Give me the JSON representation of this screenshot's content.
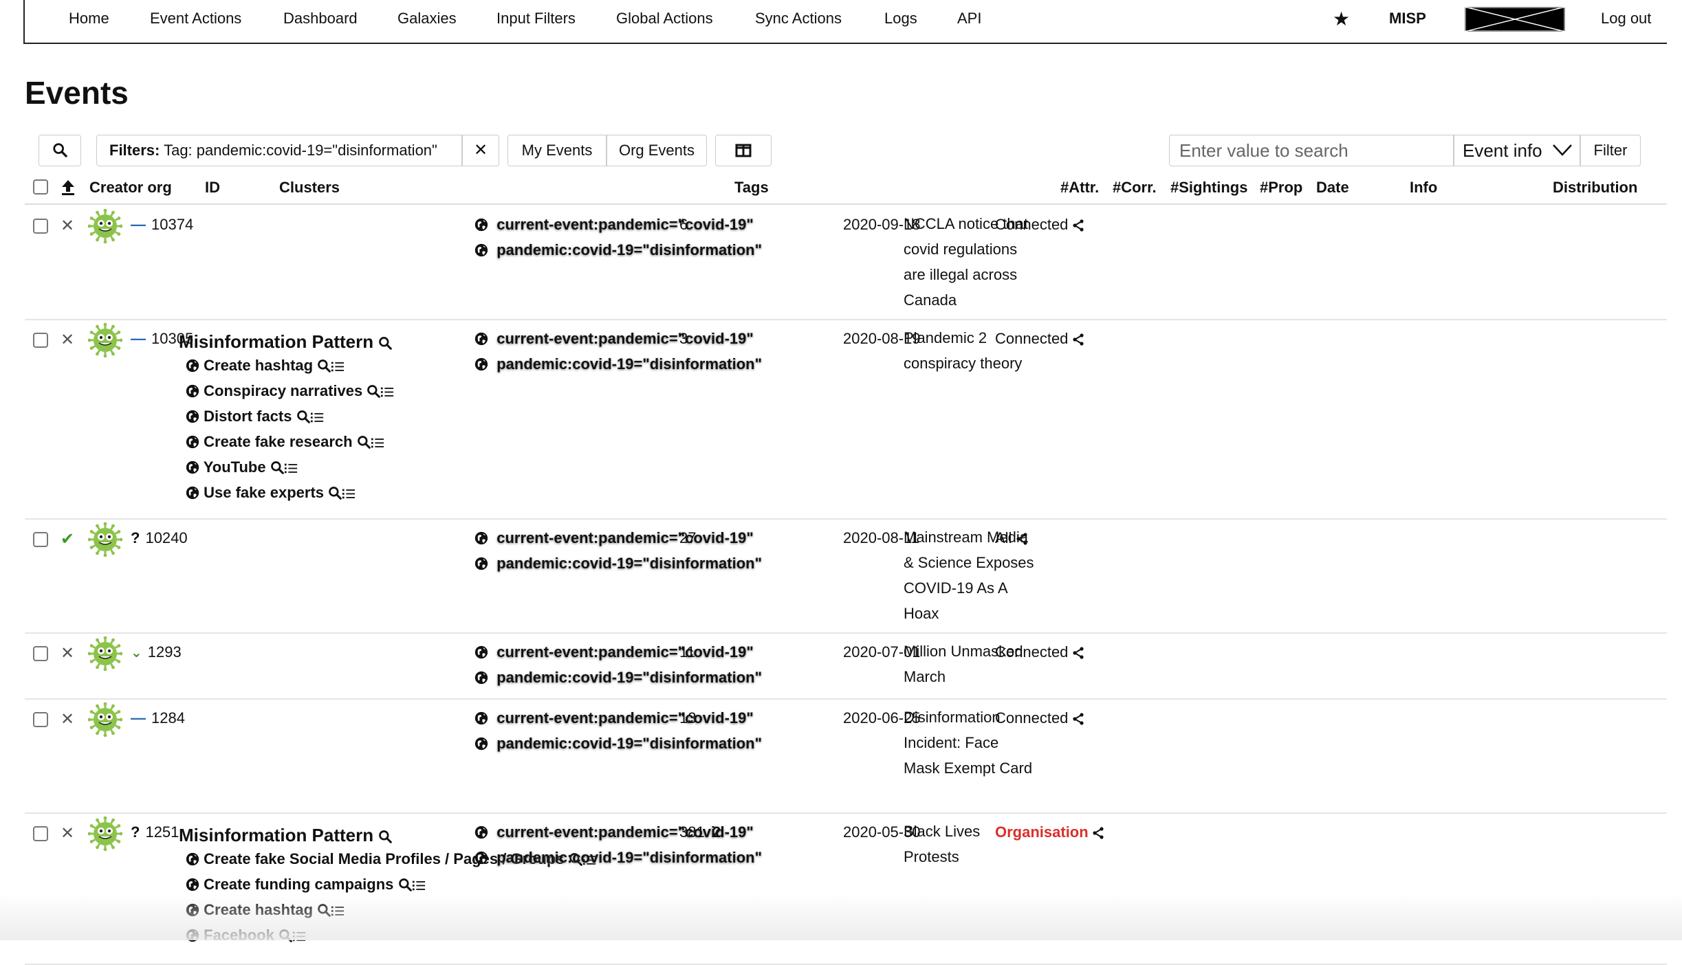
{
  "nav": {
    "items": [
      "Home",
      "Event Actions",
      "Dashboard",
      "Galaxies",
      "Input Filters",
      "Global Actions",
      "Sync Actions",
      "Logs",
      "API"
    ],
    "brand": "MISP",
    "logout": "Log out",
    "star_icon": "star-icon"
  },
  "page": {
    "title": "Events"
  },
  "filterbar": {
    "filter_label": "Filters:",
    "filter_value": "Tag: pandemic:covid-19=\"disinformation\"",
    "my_events": "My Events",
    "org_events": "Org Events",
    "search_placeholder": "Enter value to search",
    "search_scope": "Event info",
    "filter_button": "Filter"
  },
  "table": {
    "headers": {
      "creator_org": "Creator org",
      "id": "ID",
      "clusters": "Clusters",
      "tags": "Tags",
      "attr": "#Attr.",
      "corr": "#Corr.",
      "sightings": "#Sightings",
      "prop": "#Prop",
      "date": "Date",
      "info": "Info",
      "distribution": "Distribution"
    },
    "rows": [
      {
        "id": "10374",
        "status": "dash",
        "published": false,
        "cluster_title": "",
        "clusters": [],
        "tags": [
          "current-event:pandemic=\"covid-19\"",
          "pandemic:covid-19=\"disinformation\""
        ],
        "attr": "6",
        "corr": "",
        "date": "2020-09-18",
        "info": "NCCLA notice that covid regulations are illegal across Canada",
        "distribution": "Connected",
        "distribution_color": "#111111"
      },
      {
        "id": "10305",
        "status": "dash",
        "published": false,
        "cluster_title": "Misinformation Pattern",
        "clusters": [
          "Create hashtag",
          "Conspiracy narratives",
          "Distort facts",
          "Create fake research",
          "YouTube",
          "Use fake experts"
        ],
        "tags": [
          "current-event:pandemic=\"covid-19\"",
          "pandemic:covid-19=\"disinformation\""
        ],
        "attr": "3",
        "corr": "",
        "date": "2020-08-19",
        "info": "Plandemic 2 conspiracy theory",
        "distribution": "Connected",
        "distribution_color": "#111111"
      },
      {
        "id": "10240",
        "status": "question",
        "published": true,
        "cluster_title": "",
        "clusters": [],
        "tags": [
          "current-event:pandemic=\"covid-19\"",
          "pandemic:covid-19=\"disinformation\""
        ],
        "attr": "27",
        "corr": "",
        "date": "2020-08-11",
        "info": "Mainstream Media & Science Exposes COVID-19 As A Hoax",
        "distribution": "All",
        "distribution_color": "#111111"
      },
      {
        "id": "1293",
        "status": "chevron",
        "published": false,
        "cluster_title": "",
        "clusters": [],
        "tags": [
          "current-event:pandemic=\"covid-19\"",
          "pandemic:covid-19=\"disinformation\""
        ],
        "attr": "11",
        "corr": "",
        "date": "2020-07-01",
        "info": "Million Unmasked March",
        "distribution": "Connected",
        "distribution_color": "#111111"
      },
      {
        "id": "1284",
        "status": "dash",
        "published": false,
        "cluster_title": "",
        "clusters": [],
        "tags": [
          "current-event:pandemic=\"covid-19\"",
          "pandemic:covid-19=\"disinformation\""
        ],
        "attr": "13",
        "corr": "",
        "date": "2020-06-25",
        "info": "Disinformation Incident: Face Mask Exempt Card",
        "distribution": "Connected",
        "distribution_color": "#111111"
      },
      {
        "id": "1251",
        "status": "question",
        "published": false,
        "cluster_title": "Misinformation Pattern",
        "clusters": [
          "Create fake Social Media Profiles / Pages / Groups",
          "Create funding campaigns",
          "Create hashtag",
          "Facebook"
        ],
        "tags": [
          "current-event:pandemic=\"covid-19\"",
          "pandemic:covid-19=\"disinformation\""
        ],
        "attr": "381",
        "corr": "2",
        "date": "2020-05-30",
        "info": "Black Lives Protests",
        "distribution": "Organisation",
        "distribution_color": "#d9302b"
      }
    ]
  },
  "colors": {
    "accent_blue": "#2a6ab0",
    "published_green": "#3a9a2a",
    "org_red": "#d9302b",
    "logo_green": "#8cc34a"
  }
}
